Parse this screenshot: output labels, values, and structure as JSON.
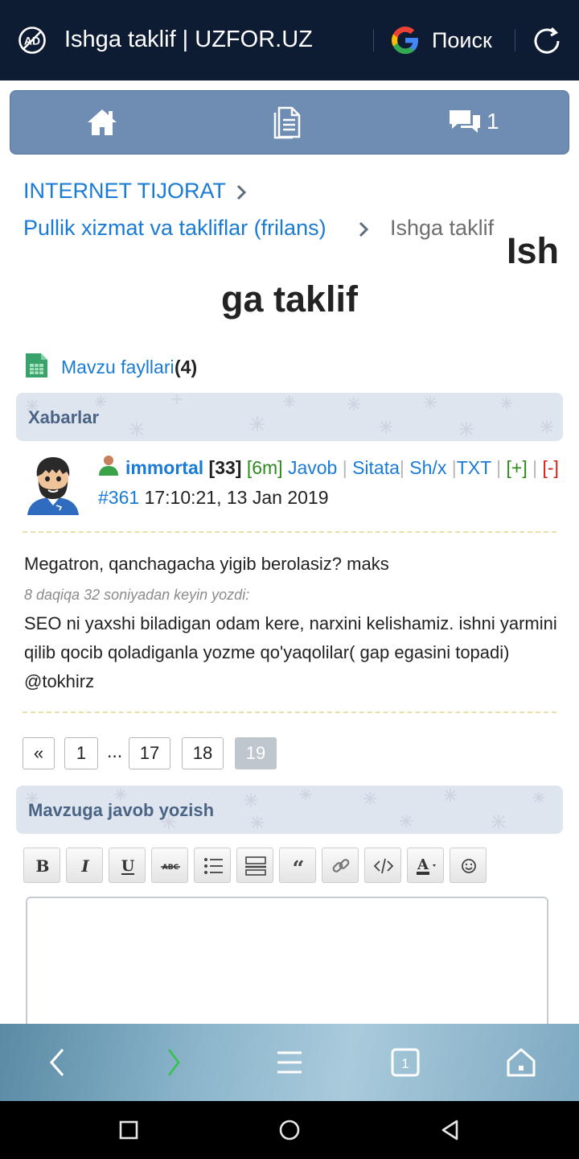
{
  "browser": {
    "title": "Ishga taklif | UZFOR.UZ",
    "search_label": "Поиск",
    "icons": [
      "ad-block-icon",
      "google-icon",
      "refresh-icon"
    ]
  },
  "site_nav": {
    "icons": [
      "home-icon",
      "forum-list-icon",
      "messages-icon"
    ],
    "messages_count": "1",
    "color": "#6f8db2"
  },
  "breadcrumb": {
    "items": [
      {
        "label": "INTERNET TIJORAT"
      },
      {
        "label": "Pullik xizmat va takliflar (frilans)"
      }
    ],
    "current": "Ishga taklif"
  },
  "page": {
    "title_part1": "Ish",
    "title_part2": "ga taklif"
  },
  "files": {
    "label": "Mavzu fayllari",
    "count": "(4)"
  },
  "posts_section": {
    "label": "Xabarlar"
  },
  "post": {
    "username": "immortal",
    "rating": "[33]",
    "online": "[6m]",
    "reply": "Javob",
    "quote": "Sitata",
    "pm": "Sh/x",
    "txt": "TXT",
    "plus": "[+]",
    "minus": "[-]",
    "number": "#361",
    "datetime": "17:10:21, 13 Jan 2019",
    "lines": [
      "Megatron, qanchagacha yigib berolasiz? maks",
      "SEO ni yaxshi biladigan odam kere, narxini kelishamiz. ishni yarmini",
      "qilib qocib qoladiganla yozme qo'yaqolilar( gap egasini topadi)",
      "@tokhirz"
    ],
    "edit_note": "8 daqiqa 32 soniyadan keyin yozdi:"
  },
  "pagination": {
    "first": "«",
    "pages": [
      "1",
      "17",
      "18",
      "19"
    ],
    "dots": "...",
    "current": "19"
  },
  "reply_section": {
    "label": "Mavzuga javob yozish"
  },
  "toolbar": {
    "buttons": [
      "bold-icon",
      "italic-icon",
      "underline-icon",
      "strikethrough-icon",
      "list-icon",
      "horizontal-rule-icon",
      "quote-icon",
      "link-icon",
      "code-icon",
      "font-color-icon",
      "smiley-icon"
    ]
  },
  "bottom_nav": {
    "icons": [
      "back-icon",
      "forward-icon",
      "menu-icon",
      "tabs-icon",
      "home-icon"
    ],
    "tabs_count": "1"
  },
  "system_nav": {
    "icons": [
      "recents-icon",
      "home-circle-icon",
      "back-triangle-icon"
    ]
  },
  "colors": {
    "link": "#1a7bd6",
    "topbar": "#0d1b33",
    "online": "#2b8a1a",
    "minus": "#d0211c"
  }
}
